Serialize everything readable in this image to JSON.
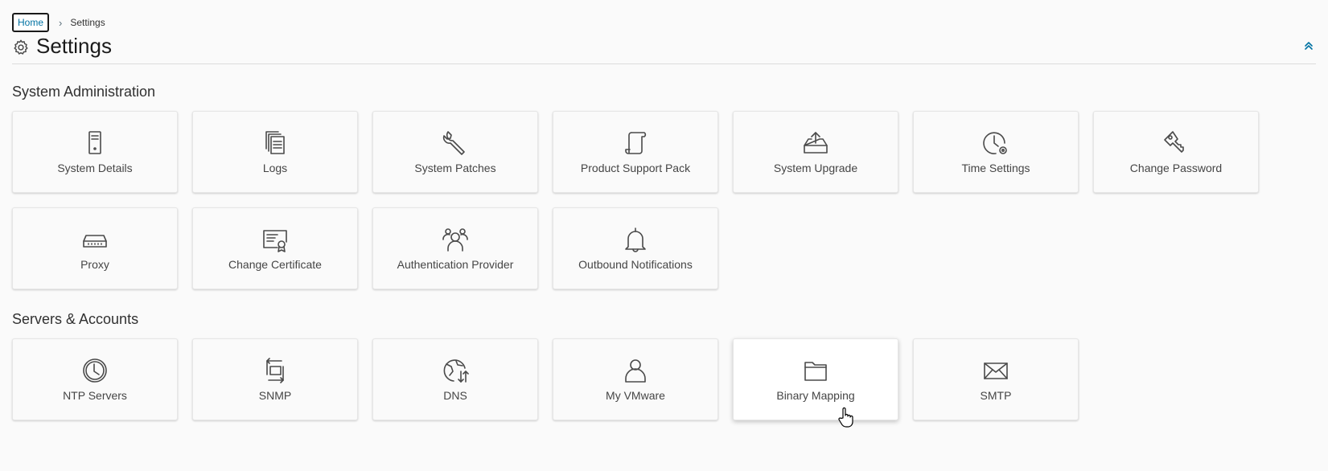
{
  "breadcrumb": {
    "home": "Home",
    "separator": "›",
    "current": "Settings"
  },
  "page": {
    "title": "Settings",
    "icon": "gear-icon",
    "accent": "#0072a3"
  },
  "sections": [
    {
      "title": "System Administration",
      "tiles": [
        {
          "label": "System Details",
          "icon": "server-icon"
        },
        {
          "label": "Logs",
          "icon": "logs-icon"
        },
        {
          "label": "System Patches",
          "icon": "wrench-icon"
        },
        {
          "label": "Product Support Pack",
          "icon": "scroll-icon"
        },
        {
          "label": "System Upgrade",
          "icon": "upload-tray-icon"
        },
        {
          "label": "Time Settings",
          "icon": "clock-gear-icon"
        },
        {
          "label": "Change Password",
          "icon": "key-icon"
        },
        {
          "label": "Proxy",
          "icon": "network-device-icon"
        },
        {
          "label": "Change Certificate",
          "icon": "certificate-icon"
        },
        {
          "label": "Authentication Provider",
          "icon": "users-icon"
        },
        {
          "label": "Outbound Notifications",
          "icon": "bell-icon"
        }
      ]
    },
    {
      "title": "Servers & Accounts",
      "tiles": [
        {
          "label": "NTP Servers",
          "icon": "clock-icon"
        },
        {
          "label": "SNMP",
          "icon": "snmp-icon"
        },
        {
          "label": "DNS",
          "icon": "globe-icon"
        },
        {
          "label": "My VMware",
          "icon": "user-icon"
        },
        {
          "label": "Binary Mapping",
          "icon": "folder-icon"
        },
        {
          "label": "SMTP",
          "icon": "envelope-icon"
        }
      ]
    }
  ]
}
